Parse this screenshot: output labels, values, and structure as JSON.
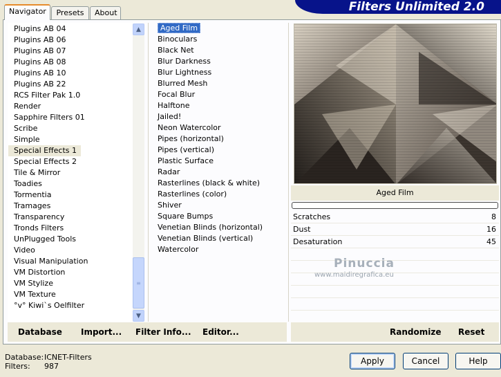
{
  "tabs": [
    {
      "label": "Navigator"
    },
    {
      "label": "Presets"
    },
    {
      "label": "About"
    }
  ],
  "banner_title": "Filters Unlimited 2.0",
  "categories": [
    "Plugins AB 04",
    "Plugins AB 06",
    "Plugins AB 07",
    "Plugins AB 08",
    "Plugins AB 10",
    "Plugins AB 22",
    "RCS Filter Pak 1.0",
    "Render",
    "Sapphire Filters 01",
    "Scribe",
    "Simple",
    "Special Effects 1",
    "Special Effects 2",
    "Tile & Mirror",
    "Toadies",
    "Tormentia",
    "Tramages",
    "Transparency",
    "Tronds Filters",
    "UnPlugged Tools",
    "Video",
    "Visual Manipulation",
    "VM Distortion",
    "VM Stylize",
    "VM Texture",
    "°v° Kiwi`s Oelfilter"
  ],
  "selected_category": "Special Effects 1",
  "filters": [
    "Aged Film",
    "Binoculars",
    "Black Net",
    "Blur Darkness",
    "Blur Lightness",
    "Blurred Mesh",
    "Focal Blur",
    "Halftone",
    "Jailed!",
    "Neon Watercolor",
    "Pipes (horizontal)",
    "Pipes (vertical)",
    "Plastic Surface",
    "Radar",
    "Rasterlines (black & white)",
    "Rasterlines (color)",
    "Shiver",
    "Square Bumps",
    "Venetian Blinds (horizontal)",
    "Venetian Blinds (vertical)",
    "Watercolor"
  ],
  "selected_filter": "Aged Film",
  "filter_name": "Aged Film",
  "params": [
    {
      "name": "Scratches",
      "value": "8"
    },
    {
      "name": "Dust",
      "value": "16"
    },
    {
      "name": "Desaturation",
      "value": "45"
    }
  ],
  "watermark": {
    "name": "Pinuccia",
    "site": "www.maidiregrafica.eu"
  },
  "toolbar": {
    "database": "Database",
    "import": "Import...",
    "filter_info": "Filter Info...",
    "editor": "Editor...",
    "randomize": "Randomize",
    "reset": "Reset"
  },
  "footer": {
    "database_label": "Database:",
    "database_value": "ICNET-Filters",
    "filters_label": "Filters:",
    "filters_value": "987"
  },
  "buttons": {
    "apply": "Apply",
    "cancel": "Cancel",
    "help": "Help"
  },
  "colors": {
    "banner": "#07138a",
    "selection": "#316ac5",
    "tab_accent": "#e68b2c"
  }
}
